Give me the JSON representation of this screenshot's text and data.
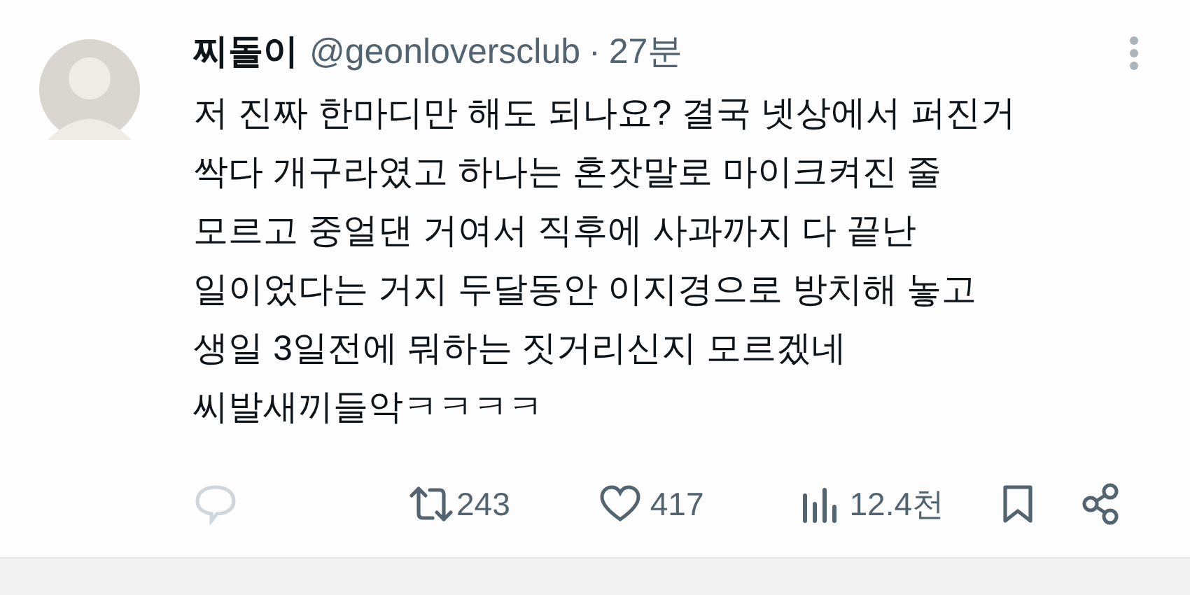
{
  "author": {
    "name": "찌돌이",
    "handle": "@geonloversclub",
    "separator": "·",
    "time": "27분"
  },
  "body_lines": [
    "저 진짜 한마디만 해도 되나요? 결국 넷상에서 퍼진거",
    "싹다 개구라였고 하나는 혼잣말로 마이크켜진 줄",
    "모르고 중얼댄 거여서 직후에 사과까지 다 끝난",
    "일이었다는 거지 두달동안 이지경으로 방치해 놓고",
    "생일 3일전에 뭐하는 짓거리신지 모르겠네",
    "씨발새끼들악ㅋㅋㅋㅋ"
  ],
  "actions": {
    "reply_disabled": true,
    "retweets": "243",
    "likes": "417",
    "views": "12.4천"
  }
}
